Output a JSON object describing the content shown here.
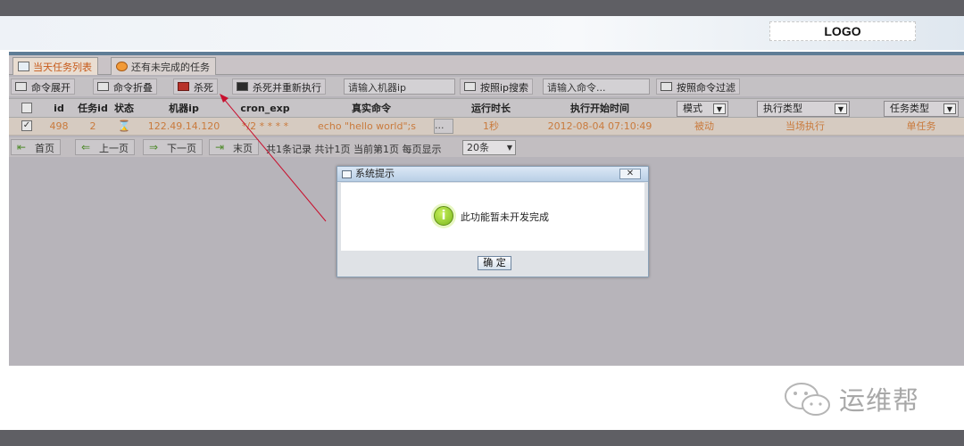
{
  "header": {
    "logo": "LOGO"
  },
  "tabs": [
    {
      "label": "当天任务列表",
      "active": true
    },
    {
      "label": "还有未完成的任务",
      "active": false
    }
  ],
  "toolbar": {
    "expand_label": "命令展开",
    "collapse_label": "命令折叠",
    "kill_label": "杀死",
    "kill_restart_label": "杀死并重新执行",
    "machine_ip_placeholder": "请输入机器ip",
    "search_ip_label": "按照ip搜索",
    "command_placeholder": "请输入命令...",
    "filter_command_label": "按照命令过滤"
  },
  "grid": {
    "headers": {
      "id": "id",
      "task_id": "任务id",
      "status": "状态",
      "machine_ip": "机器ip",
      "cron_exp": "cron_exp",
      "real_command": "真实命令",
      "duration": "运行时长",
      "start_time": "执行开始时间",
      "mode": "模式",
      "exec_type": "执行类型",
      "task_type": "任务类型"
    },
    "row": {
      "checked": "✓",
      "id": "498",
      "task_id": "2",
      "machine_ip": "122.49.14.120",
      "cron_exp": "*/2 * * * *",
      "real_command": "echo \"hello world\";s",
      "more": "...",
      "duration": "1秒",
      "start_time": "2012-08-04 07:10:49",
      "mode": "被动",
      "exec_type": "当场执行",
      "task_type": "单任务"
    }
  },
  "pager": {
    "first": "首页",
    "prev": "上一页",
    "next": "下一页",
    "last": "末页",
    "summary": "共1条记录 共计1页 当前第1页 每页显示",
    "page_size": "20条"
  },
  "dialog": {
    "title": "系统提示",
    "close": "✕",
    "message": "此功能暂未开发完成",
    "ok": "确 定"
  },
  "watermark": {
    "text": "运维帮"
  },
  "colors": {
    "accent_orange": "#c75a1a",
    "frame_blue": "#5f7d96",
    "info_green": "#7ab81e"
  }
}
